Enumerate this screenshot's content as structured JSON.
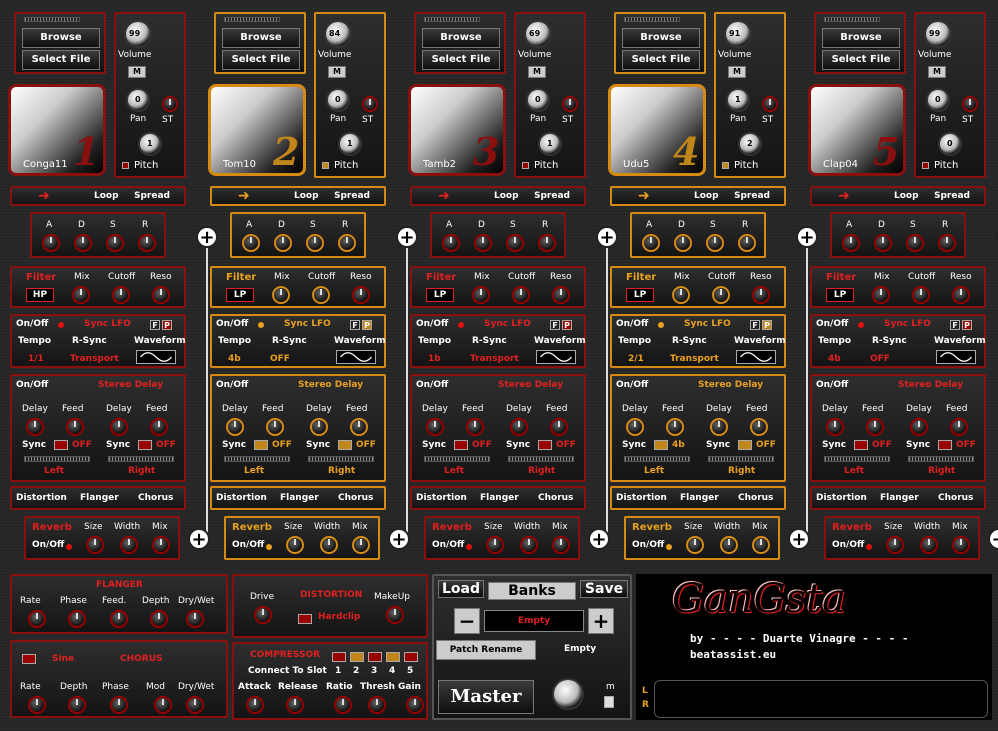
{
  "labels": {
    "browse": "Browse",
    "select_file": "Select File",
    "volume": "Volume",
    "mono": "M",
    "pan": "Pan",
    "st": "ST",
    "pitch": "Pitch",
    "loop": "Loop",
    "spread": "Spread",
    "a": "A",
    "d": "D",
    "s": "S",
    "r": "R",
    "filter": "Filter",
    "mix": "Mix",
    "cutoff": "Cutoff",
    "reso": "Reso",
    "onoff": "On/Off",
    "sync_lfo": "Sync LFO",
    "tempo": "Tempo",
    "rsync": "R-Sync",
    "waveform": "Waveform",
    "stereo_delay": "Stereo Delay",
    "delay": "Delay",
    "feed": "Feed",
    "sync": "Sync",
    "left": "Left",
    "right": "Right",
    "distortion": "Distortion",
    "flanger": "Flanger",
    "chorus": "Chorus",
    "reverb": "Reverb",
    "size": "Size",
    "width": "Width",
    "f": "F",
    "p": "P"
  },
  "slots": [
    {
      "num": "1",
      "sample": "Conga11",
      "volume": "99",
      "pan": "0",
      "pitch": "1",
      "filter": "HP",
      "tempo": "1/1",
      "rsync": "Transport",
      "sync_l": "OFF",
      "sync_r": "OFF",
      "theme": "red"
    },
    {
      "num": "2",
      "sample": "Tom10",
      "volume": "84",
      "pan": "0",
      "pitch": "1",
      "filter": "LP",
      "tempo": "4b",
      "rsync": "OFF",
      "sync_l": "OFF",
      "sync_r": "OFF",
      "theme": "gold"
    },
    {
      "num": "3",
      "sample": "Tamb2",
      "volume": "69",
      "pan": "0",
      "pitch": "1",
      "filter": "LP",
      "tempo": "1b",
      "rsync": "Transport",
      "sync_l": "OFF",
      "sync_r": "OFF",
      "theme": "red"
    },
    {
      "num": "4",
      "sample": "Udu5",
      "volume": "91",
      "pan": "1",
      "pitch": "2",
      "filter": "LP",
      "tempo": "2/1",
      "rsync": "Transport",
      "sync_l": "4b",
      "sync_r": "OFF",
      "theme": "gold"
    },
    {
      "num": "5",
      "sample": "Clap04",
      "volume": "99",
      "pan": "0",
      "pitch": "0",
      "filter": "LP",
      "tempo": "4b",
      "rsync": "OFF",
      "sync_l": "OFF",
      "sync_r": "OFF",
      "theme": "red"
    }
  ],
  "flanger": {
    "title": "FLANGER",
    "rate": "Rate",
    "phase": "Phase",
    "feed": "Feed.",
    "depth": "Depth",
    "drywet": "Dry/Wet"
  },
  "chorus": {
    "title": "CHORUS",
    "wave": "Sine",
    "rate": "Rate",
    "depth": "Depth",
    "phase": "Phase",
    "mod": "Mod",
    "drywet": "Dry/Wet"
  },
  "distortion": {
    "drive": "Drive",
    "title": "DISTORTION",
    "makeup": "MakeUp",
    "mode": "Hardclip"
  },
  "compressor": {
    "title": "COMPRESSOR",
    "connect": "Connect To Slot",
    "slots": [
      "1",
      "2",
      "3",
      "4",
      "5"
    ],
    "attack": "Attack",
    "release": "Release",
    "ratio": "Ratio",
    "thresh": "Thresh",
    "gain": "Gain"
  },
  "banks": {
    "load": "Load",
    "title": "Banks",
    "save": "Save",
    "minus": "−",
    "plus": "+",
    "current": "Empty",
    "rename": "Patch Rename",
    "rename_value": "Empty",
    "master": "Master",
    "m": "m",
    "l": "L",
    "r": "R"
  },
  "brand": {
    "logo": "GanGsta",
    "credit": "by - - - - Duarte Vinagre - - - -",
    "site": "beatassist.eu"
  },
  "colors": {
    "red": "#8a1010",
    "gold": "#d68a14",
    "bright_red": "#e02020"
  }
}
